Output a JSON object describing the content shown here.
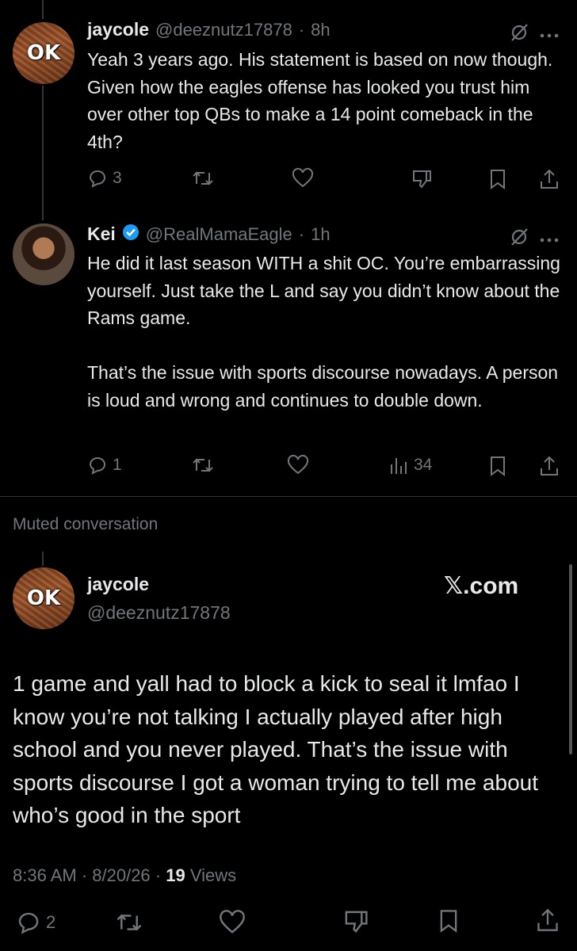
{
  "reply1": {
    "name": "jaycole",
    "handle": "@deeznutz17878",
    "time": "8h",
    "avatar_text": "OK",
    "text": "Yeah 3 years ago. His statement is based on now though. Given how the eagles offense has looked you trust him over other top QBs to make a 14 point comeback in the 4th?",
    "replies": "3"
  },
  "reply2": {
    "name": "Kei",
    "handle": "@RealMamaEagle",
    "time": "1h",
    "text": "He did it last season WITH a shit OC. You’re embarrassing yourself. Just take the L and say you didn’t know about the Rams game.\n\nThat’s the issue with sports discourse nowadays. A person is loud and wrong and continues to double down.",
    "replies": "1",
    "views": "34"
  },
  "muted_label": "Muted conversation",
  "main": {
    "name": "jaycole",
    "handle": "@deeznutz17878",
    "avatar_text": "OK",
    "brand": "𝕏.com",
    "text": "1 game and yall had to block a kick to seal it lmfao I know you’re not talking I actually played after high school and you never played. That’s the issue with sports discourse I got a woman trying to tell me about who’s good in the sport",
    "time": "8:36 AM · 8/20/26 · ",
    "views_count": "19",
    "views_label": " Views",
    "replies": "2"
  },
  "colors": {
    "bg": "#000000",
    "text": "#e7e9ea",
    "muted": "#71767b",
    "verified": "#1d9bf0"
  },
  "icons": [
    "reply-icon",
    "retweet-icon",
    "like-icon",
    "dislike-icon",
    "bookmark-icon",
    "share-icon",
    "views-icon",
    "grok-icon",
    "more-icon",
    "verified-icon"
  ]
}
